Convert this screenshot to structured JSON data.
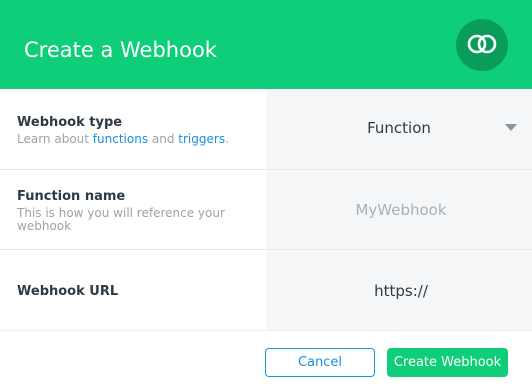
{
  "dialog": {
    "title": "Create a Webhook",
    "logo_icon": "realm-logo-icon"
  },
  "webhook_type": {
    "label": "Webhook type",
    "help_prefix": "Learn about ",
    "functions_link": "functions",
    "help_middle": " and ",
    "triggers_link": "triggers",
    "help_suffix": ".",
    "selected_value": "Function"
  },
  "function_name": {
    "label": "Function name",
    "help_line1": "This is how you will reference your",
    "help_line2": "webhook",
    "placeholder": "MyWebhook",
    "value": ""
  },
  "webhook_url": {
    "label": "Webhook URL",
    "value": "https://"
  },
  "actions": {
    "cancel_label": "Cancel",
    "create_label": "Create Webhook"
  },
  "colors": {
    "brand_green": "#0ece79",
    "logo_circle": "#0a9c5b",
    "link_blue": "#1a90dc"
  }
}
